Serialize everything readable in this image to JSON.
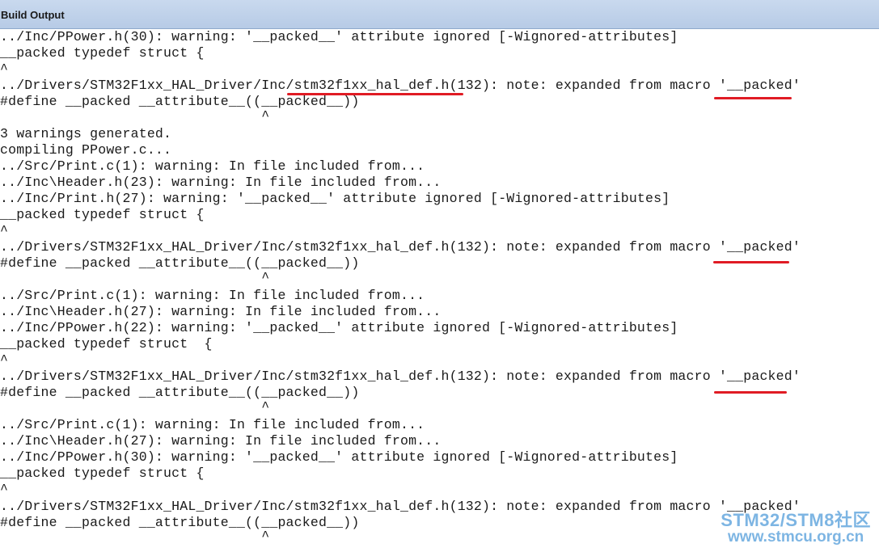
{
  "panel": {
    "title": "Build Output"
  },
  "output": {
    "lines": [
      "../Inc/PPower.h(30): warning: '__packed__' attribute ignored [-Wignored-attributes]",
      "__packed typedef struct {",
      "^",
      "../Drivers/STM32F1xx_HAL_Driver/Inc/stm32f1xx_hal_def.h(132): note: expanded from macro '__packed'",
      "#define __packed __attribute__((__packed__))",
      "                                ^",
      "",
      "3 warnings generated.",
      "compiling PPower.c...",
      "../Src/Print.c(1): warning: In file included from...",
      "../Inc\\Header.h(23): warning: In file included from...",
      "../Inc/Print.h(27): warning: '__packed__' attribute ignored [-Wignored-attributes]",
      "__packed typedef struct {",
      "^",
      "../Drivers/STM32F1xx_HAL_Driver/Inc/stm32f1xx_hal_def.h(132): note: expanded from macro '__packed'",
      "#define __packed __attribute__((__packed__))",
      "                                ^",
      "../Src/Print.c(1): warning: In file included from...",
      "../Inc\\Header.h(27): warning: In file included from...",
      "../Inc/PPower.h(22): warning: '__packed__' attribute ignored [-Wignored-attributes]",
      "__packed typedef struct  {",
      "^",
      "../Drivers/STM32F1xx_HAL_Driver/Inc/stm32f1xx_hal_def.h(132): note: expanded from macro '__packed'",
      "#define __packed __attribute__((__packed__))",
      "                                ^",
      "../Src/Print.c(1): warning: In file included from...",
      "../Inc\\Header.h(27): warning: In file included from...",
      "../Inc/PPower.h(30): warning: '__packed__' attribute ignored [-Wignored-attributes]",
      "__packed typedef struct {",
      "^",
      "../Drivers/STM32F1xx_HAL_Driver/Inc/stm32f1xx_hal_def.h(132): note: expanded from macro '__packed'",
      "#define __packed __attribute__((__packed__))",
      "                                ^"
    ]
  },
  "annotation_color": "#e01b24",
  "watermark": {
    "line1": "STM32/STM8社区",
    "line2": "www.stmcu.org.cn"
  }
}
